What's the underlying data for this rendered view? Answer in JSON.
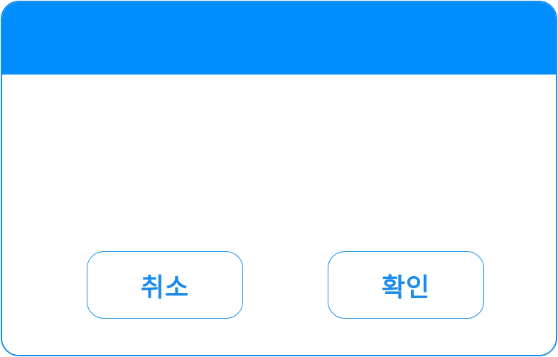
{
  "dialog": {
    "header_color": "#008EFF",
    "border_color": "#1590EA",
    "cancel_label": "취소",
    "confirm_label": "확인"
  }
}
